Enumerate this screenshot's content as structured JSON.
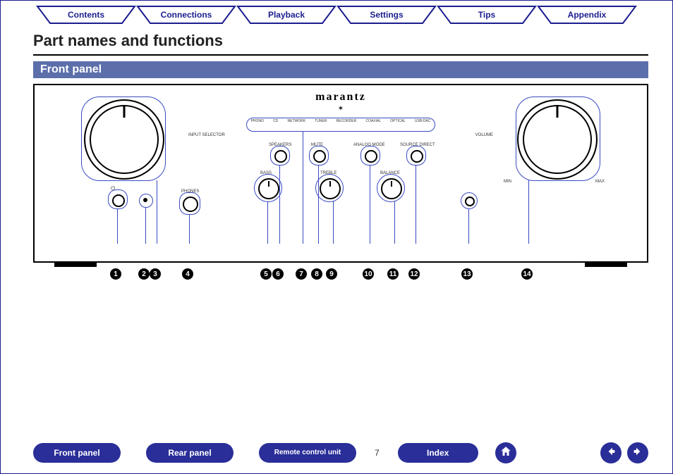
{
  "tabs": {
    "contents": "Contents",
    "connections": "Connections",
    "playback": "Playback",
    "settings": "Settings",
    "tips": "Tips",
    "appendix": "Appendix"
  },
  "heading": "Part names and functions",
  "section": "Front panel",
  "brand": "marantz",
  "panel_labels": {
    "input_selector": "INPUT SELECTOR",
    "phones": "PHONES",
    "volume": "VOLUME",
    "min": "MIN",
    "max": "MAX",
    "speakers": "SPEAKERS",
    "mute": "MUTE",
    "analog_mode": "ANALOG MODE",
    "source_direct": "SOURCE DIRECT",
    "bass": "BASS",
    "treble": "TREBLE",
    "balance": "BALANCE"
  },
  "strip_inputs": [
    "PHONO",
    "CD",
    "NETWORK",
    "TUNER",
    "RECORDER",
    "COAXIAL",
    "OPTICAL",
    "USB-DAC"
  ],
  "callouts": [
    "1",
    "2",
    "3",
    "4",
    "5",
    "6",
    "7",
    "8",
    "9",
    "10",
    "11",
    "12",
    "13",
    "14"
  ],
  "page_number": "7",
  "bottom_nav": {
    "front_panel": "Front panel",
    "rear_panel": "Rear panel",
    "remote": "Remote control unit",
    "index": "Index"
  }
}
